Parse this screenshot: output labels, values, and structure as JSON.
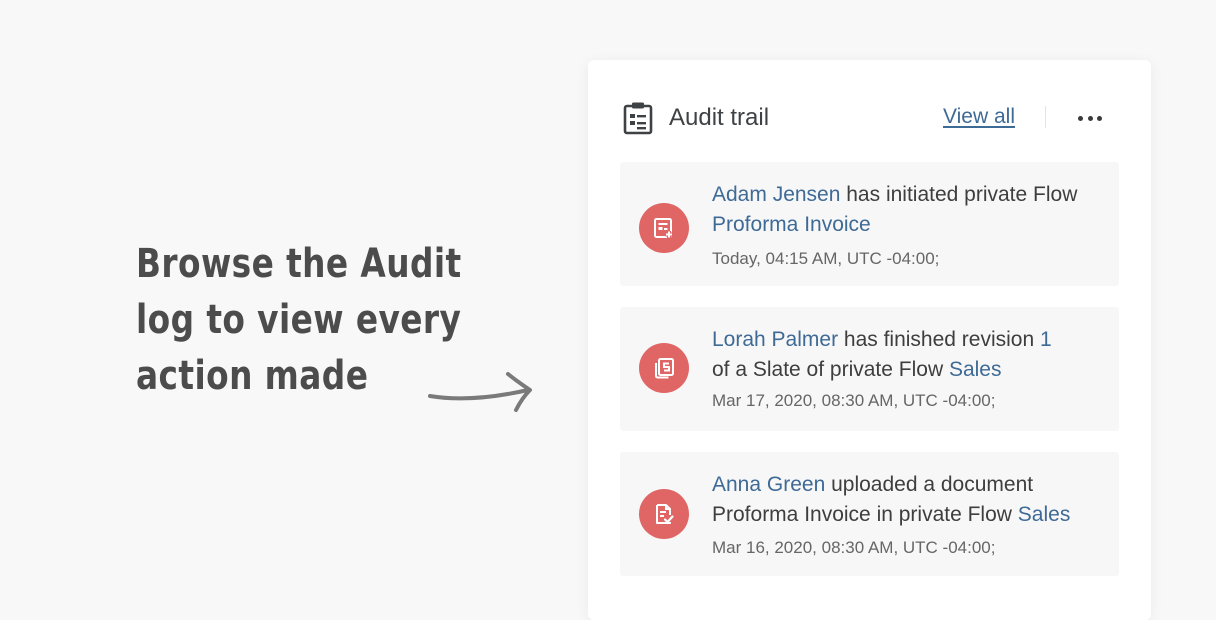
{
  "callout": {
    "lines": [
      "Browse the Audit",
      "log to view every",
      "action made"
    ]
  },
  "header": {
    "icon": "clipboard-list-icon",
    "title": "Audit trail",
    "view_all": "View all",
    "more_icon": "more-horizontal-icon"
  },
  "entries": [
    {
      "icon": "document-add-icon",
      "user": "Adam Jensen",
      "action": " has initiated private Flow ",
      "target": "Proforma Invoice",
      "time": "Today, 04:15 AM, UTC -04:00;"
    },
    {
      "icon": "slate-copy-icon",
      "user": "Lorah Palmer",
      "action": " has finished revision ",
      "revision": "1",
      "action2": " of a Slate of private Flow ",
      "target": "Sales",
      "time": "Mar 17, 2020, 08:30 AM, UTC -04:00;"
    },
    {
      "icon": "document-check-icon",
      "user": "Anna Green",
      "action": " uploaded a document Proforma Invoice in private Flow ",
      "target": "Sales",
      "time": "Mar 16, 2020, 08:30 AM, UTC -04:00;"
    }
  ],
  "colors": {
    "accent": "#e06666",
    "link": "#3e6a96",
    "text": "#3e3e3e"
  }
}
